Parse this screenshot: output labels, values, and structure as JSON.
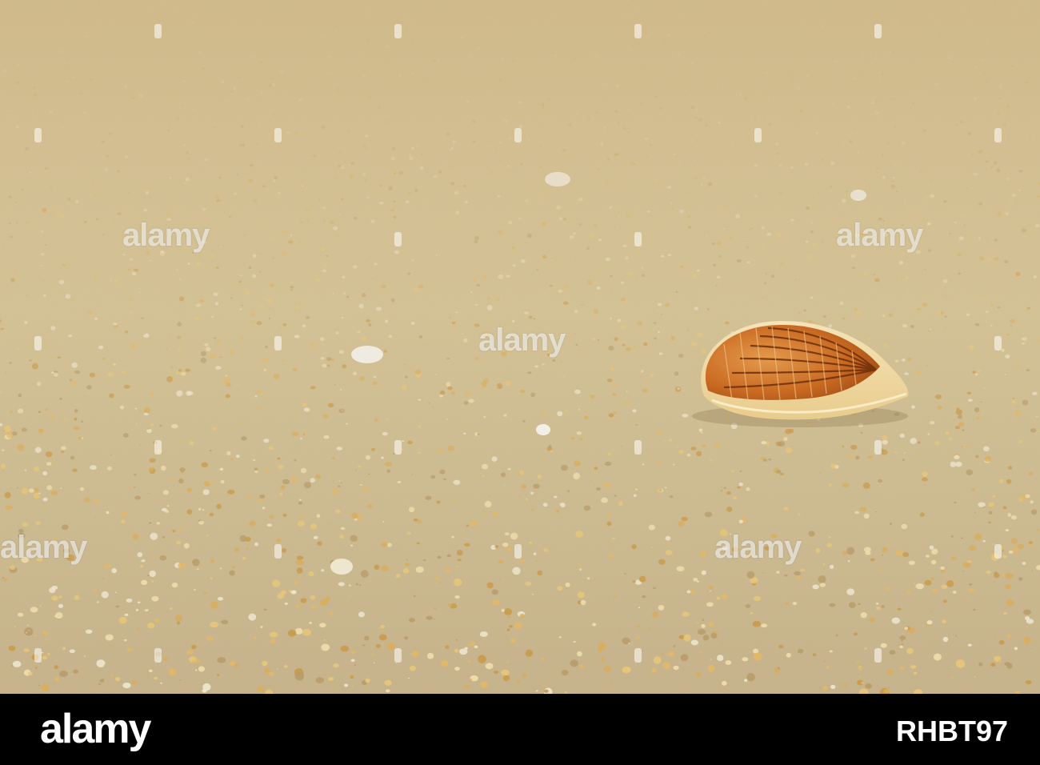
{
  "photo": {
    "subject": "seashell on sand",
    "colors": {
      "sand_light": "#e3cf9e",
      "sand_mid": "#cdb37b",
      "sand_dark": "#9c8a62",
      "shell_orange": "#c86a1f",
      "shell_dark": "#8a3d10",
      "shell_light": "#f2d9a0"
    }
  },
  "watermark": {
    "text": "alamy"
  },
  "footer": {
    "logo": "alamy",
    "image_id": "RHBT97"
  }
}
